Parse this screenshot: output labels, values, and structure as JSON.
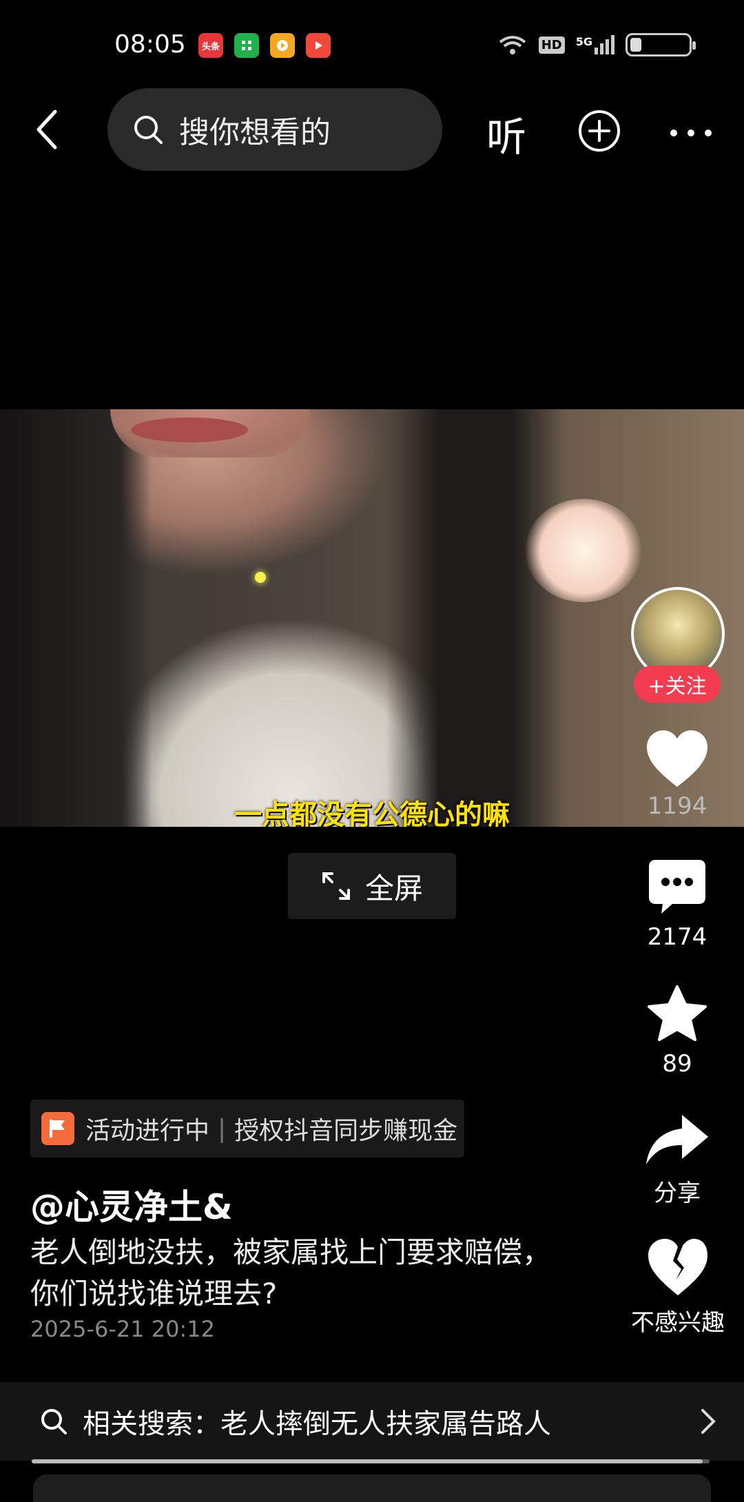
{
  "status_bar": {
    "time": "08:05",
    "app_icons": [
      {
        "name": "toutiao-app-icon",
        "label": "头条",
        "color": "#e8353a"
      },
      {
        "name": "green-app-icon",
        "label": "",
        "color": "#22b04a"
      },
      {
        "name": "video-app-icon",
        "label": "",
        "color": "#f5a623"
      },
      {
        "name": "play-app-icon",
        "label": "",
        "color": "#f0483a"
      }
    ],
    "hd": "HD",
    "network": "5G",
    "battery_level": 0.2
  },
  "top_bar": {
    "search_placeholder": "搜你想看的",
    "listen_label": "听"
  },
  "video": {
    "subtitle": "一点都没有公德心的嘛"
  },
  "fullscreen_label": "全屏",
  "actions": {
    "follow_label": "+关注",
    "like_count": "1194",
    "comment_count": "2174",
    "favorite_count": "89",
    "share_label": "分享",
    "not_interested_label": "不感兴趣"
  },
  "activity": {
    "status": "活动进行中",
    "text": "授权抖音同步赚现金"
  },
  "post": {
    "author": "@心灵净土&",
    "description": "老人倒地没扶，被家属找上门要求赔偿，你们说找谁说理去?",
    "date": "2025-6-21 20:12"
  },
  "related_search": {
    "text": "相关搜索：老人摔倒无人扶家属告路人"
  },
  "playback_progress": 0.99,
  "colors": {
    "accent": "#f33c4f",
    "background": "#000000",
    "subtitle": "#ffe200"
  }
}
